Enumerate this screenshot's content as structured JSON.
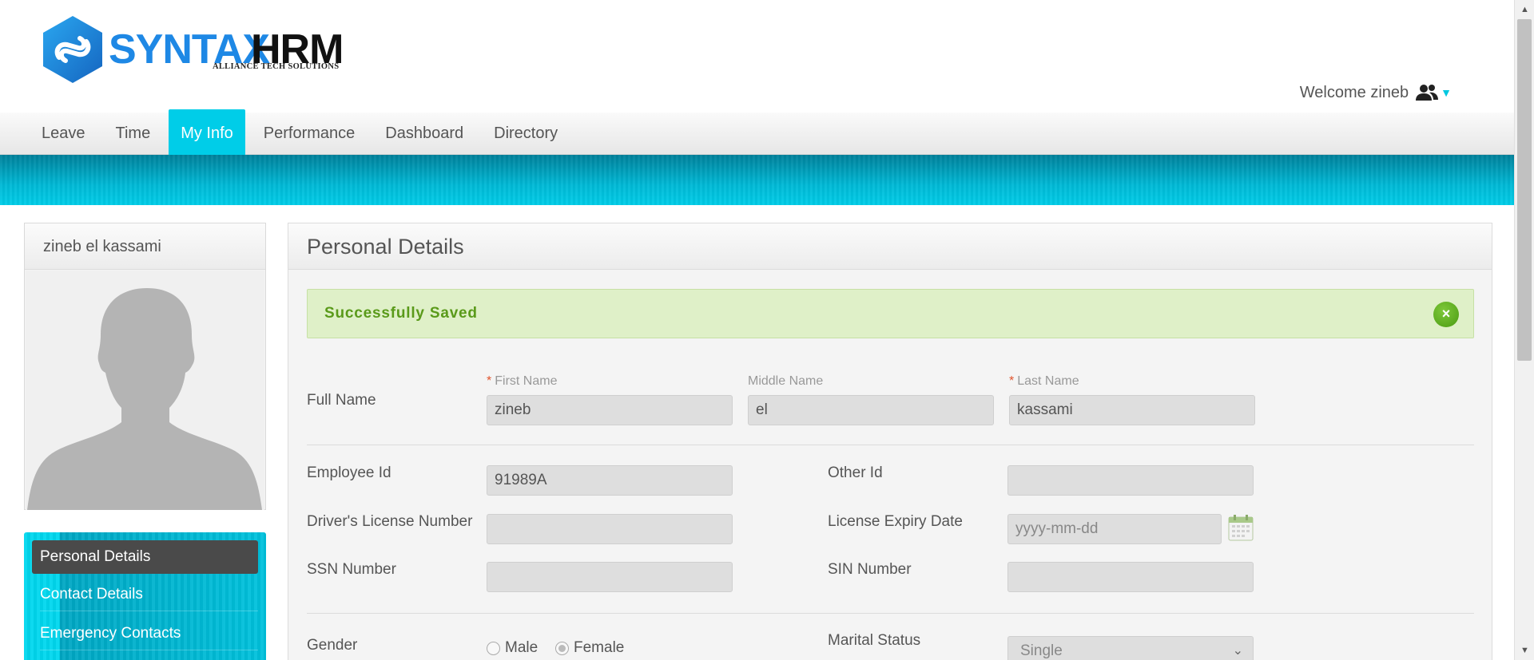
{
  "brand": {
    "name_part1": "SYNTAX",
    "name_part2": "HRM",
    "tagline": "ALLIANCE TECH SOLUTIONS",
    "colors": {
      "primary": "#1e88e5",
      "accent": "#00cde8",
      "dark": "#111111"
    }
  },
  "header": {
    "welcome_text": "Welcome zineb",
    "user_icon": "users-icon",
    "caret_icon": "caret-down-icon"
  },
  "nav": {
    "items": [
      {
        "label": "Leave",
        "active": false
      },
      {
        "label": "Time",
        "active": false
      },
      {
        "label": "My Info",
        "active": true
      },
      {
        "label": "Performance",
        "active": false
      },
      {
        "label": "Dashboard",
        "active": false
      },
      {
        "label": "Directory",
        "active": false
      }
    ]
  },
  "profile": {
    "name": "zineb el kassami",
    "photo_icon": "default-avatar-silhouette"
  },
  "sidebar": {
    "items": [
      {
        "label": "Personal Details",
        "active": true
      },
      {
        "label": "Contact Details",
        "active": false
      },
      {
        "label": "Emergency Contacts",
        "active": false
      }
    ]
  },
  "main": {
    "title": "Personal Details",
    "alert": {
      "text": "Successfully Saved",
      "close_symbol": "×",
      "color": "#dff0c8"
    },
    "full_name": {
      "label": "Full Name",
      "first_name_label": "First Name",
      "first_name_required": "*",
      "first_name_value": "zineb",
      "middle_name_label": "Middle Name",
      "middle_name_value": "el",
      "last_name_label": "Last Name",
      "last_name_required": "*",
      "last_name_value": "kassami"
    },
    "ids": {
      "employee_id_label": "Employee Id",
      "employee_id_value": "91989A",
      "other_id_label": "Other Id",
      "other_id_value": "",
      "drivers_license_label": "Driver's License Number",
      "drivers_license_value": "",
      "license_expiry_label": "License Expiry Date",
      "license_expiry_placeholder": "yyyy-mm-dd",
      "ssn_label": "SSN Number",
      "ssn_value": "",
      "sin_label": "SIN Number",
      "sin_value": ""
    },
    "gender": {
      "label": "Gender",
      "options": [
        {
          "label": "Male",
          "selected": false
        },
        {
          "label": "Female",
          "selected": true
        }
      ]
    },
    "marital_status": {
      "label": "Marital Status",
      "selected": "Single"
    }
  }
}
